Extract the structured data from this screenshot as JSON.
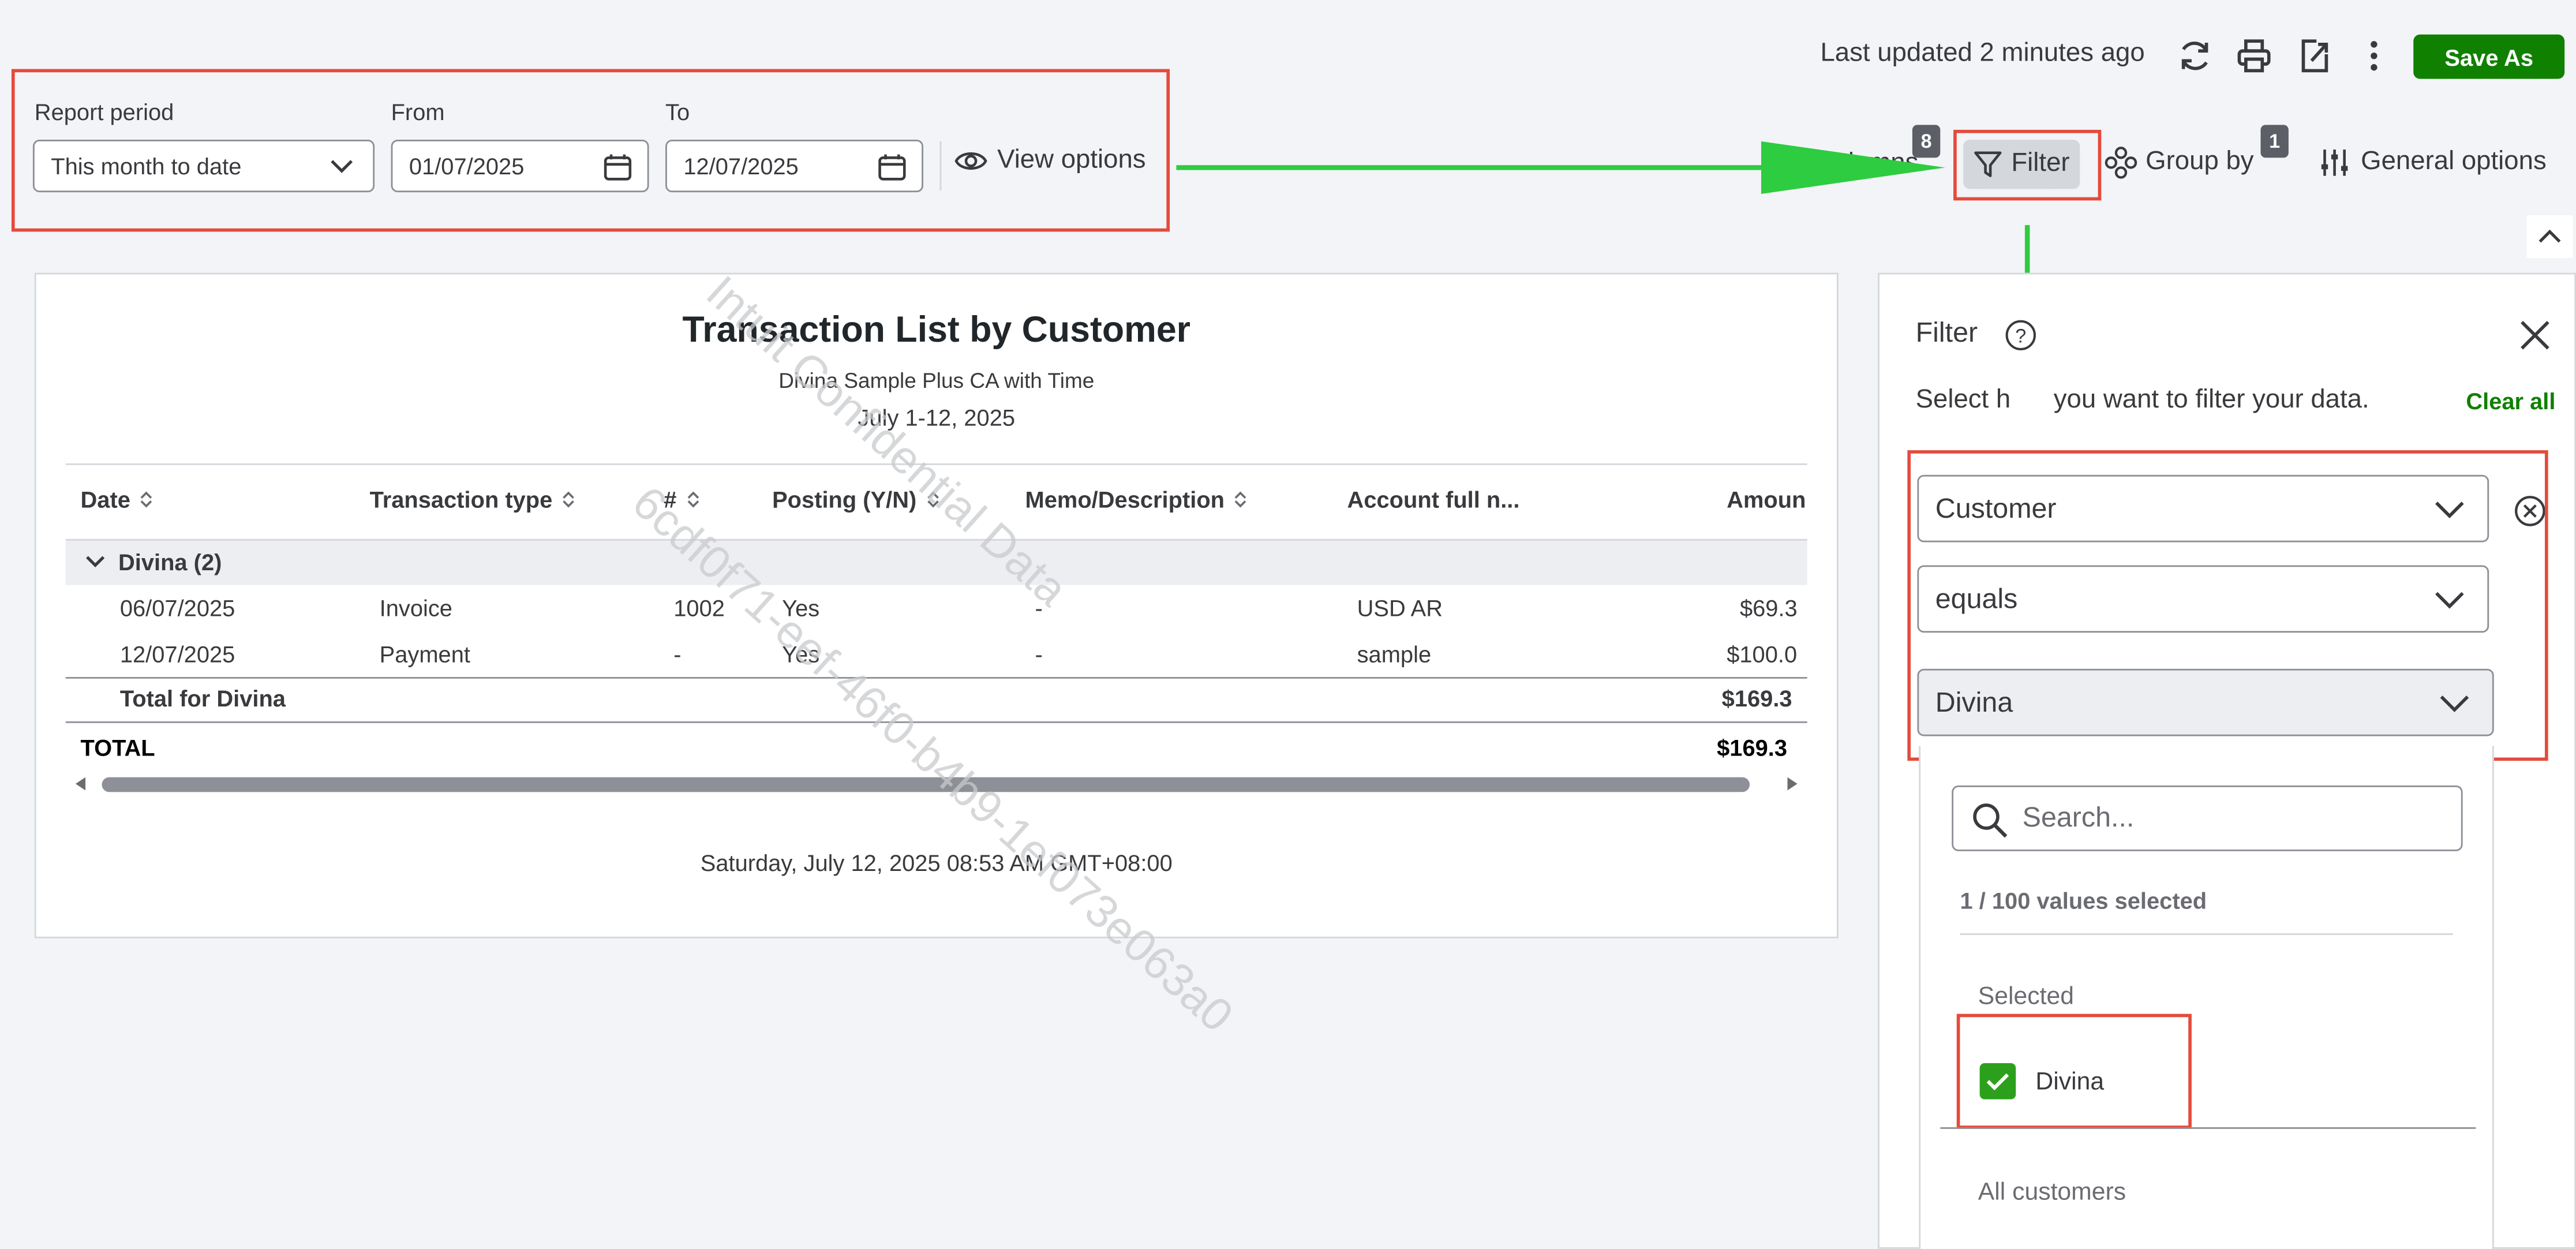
{
  "top": {
    "last_updated": "Last updated 2 minutes ago",
    "save_as": "Save As"
  },
  "period": {
    "report_period_label": "Report period",
    "report_period_value": "This month to date",
    "from_label": "From",
    "from_value": "01/07/2025",
    "to_label": "To",
    "to_value": "12/07/2025",
    "view_options": "View options"
  },
  "toolbar": {
    "columns_partial": "lumns",
    "columns_badge": "8",
    "filter": "Filter",
    "group_by": "Group by",
    "group_badge": "1",
    "general_options": "General options"
  },
  "report": {
    "title": "Transaction List by Customer",
    "company": "Divina Sample Plus CA with Time",
    "period": "July 1-12, 2025",
    "columns": [
      "Date",
      "Transaction type",
      "#",
      "Posting (Y/N)",
      "Memo/Description",
      "Account full n...",
      "Amoun"
    ],
    "group_label": "Divina (2)",
    "rows": [
      [
        "06/07/2025",
        "Invoice",
        "1002",
        "Yes",
        "-",
        "USD AR",
        "$69.3"
      ],
      [
        "12/07/2025",
        "Payment",
        "-",
        "Yes",
        "-",
        "sample",
        "$100.0"
      ]
    ],
    "total_for_label": "Total for Divina",
    "total_for_value": "$169.3",
    "total_label": "TOTAL",
    "total_value": "$169.3",
    "footer": "Saturday, July 12, 2025 08:53 AM GMT+08:00",
    "watermark_1": "6cdf0f71-eef-46f0-b4b9-1ef073e063a0",
    "watermark_2": "Intuit Confidential Data"
  },
  "filter_panel": {
    "title": "Filter",
    "hint_a": "Select h",
    "hint_b": "you want to filter your data.",
    "clear_all": "Clear all",
    "field": "Customer",
    "operator": "equals",
    "value": "Divina",
    "search_placeholder": "Search...",
    "count": "1 / 100 values selected",
    "selected_heading": "Selected",
    "selected_item": "Divina",
    "all_heading": "All customers"
  },
  "colors": {
    "accent_green": "#108000",
    "annotation_red": "#e44b3c",
    "annotation_arrow": "#2ecc40"
  }
}
